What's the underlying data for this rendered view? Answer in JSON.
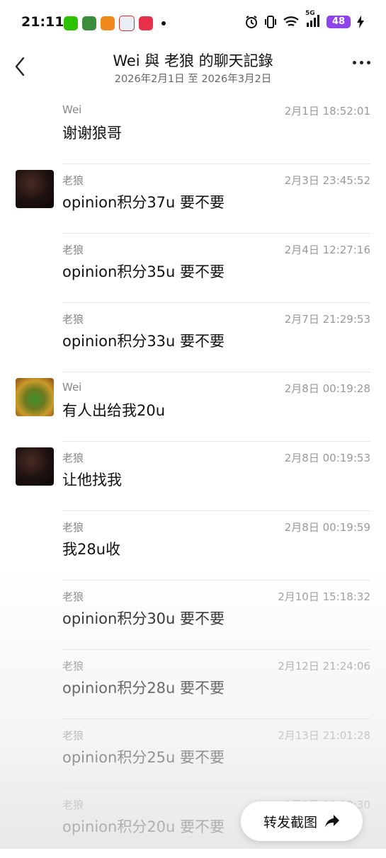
{
  "status_bar": {
    "time": "21:11",
    "battery": "48",
    "network": "5G",
    "icons": [
      "wechat-icon",
      "game-icon",
      "app-icon",
      "app-icon",
      "app-icon",
      "alarm-icon",
      "vibrate-icon",
      "wifi-icon",
      "signal-icon",
      "charging-icon"
    ]
  },
  "header": {
    "title": "Wei 與 老狼 的聊天記錄",
    "subtitle": "2026年2月1日 至 2026年3月2日"
  },
  "messages": [
    {
      "sender": "Wei",
      "time": "2月1日 18:52:01",
      "text": "谢谢狼哥",
      "avatar": ""
    },
    {
      "sender": "老狼",
      "time": "2月3日 23:45:52",
      "text": "opinion积分37u 要不要",
      "avatar": "dark"
    },
    {
      "sender": "老狼",
      "time": "2月4日 12:27:16",
      "text": "opinion积分35u 要不要",
      "avatar": ""
    },
    {
      "sender": "老狼",
      "time": "2月7日 21:29:53",
      "text": "opinion积分33u 要不要",
      "avatar": ""
    },
    {
      "sender": "Wei",
      "time": "2月8日 00:19:28",
      "text": "有人出给我20u",
      "avatar": "colorful"
    },
    {
      "sender": "老狼",
      "time": "2月8日 00:19:53",
      "text": "让他找我",
      "avatar": "dark"
    },
    {
      "sender": "老狼",
      "time": "2月8日 00:19:59",
      "text": "我28u收",
      "avatar": ""
    },
    {
      "sender": "老狼",
      "time": "2月10日 15:18:32",
      "text": "opinion积分30u 要不要",
      "avatar": ""
    },
    {
      "sender": "老狼",
      "time": "2月12日 21:24:06",
      "text": "opinion积分28u 要不要",
      "avatar": ""
    },
    {
      "sender": "老狼",
      "time": "2月13日 21:01:28",
      "text": "opinion积分25u 要不要",
      "avatar": ""
    },
    {
      "sender": "老狼",
      "time": "2月2日 12:03:30",
      "text": "opinion积分20u 要不要",
      "avatar": ""
    }
  ],
  "forward_button": {
    "label": "转发截图",
    "icon": "share-arrow-icon"
  }
}
